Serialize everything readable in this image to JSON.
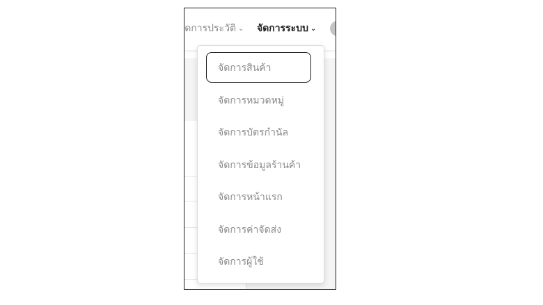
{
  "navbar": {
    "history_label": "จัดการประวัติ",
    "system_label": "จัดการระบบ",
    "chevron": "❯"
  },
  "system_menu": {
    "items": [
      {
        "label": "จัดการสินค้า",
        "focused": true
      },
      {
        "label": "จัดการหมวดหมู่",
        "focused": false
      },
      {
        "label": "จัดการบัตรกำนัล",
        "focused": false
      },
      {
        "label": "จัดการข้อมูลร้านค้า",
        "focused": false
      },
      {
        "label": "จัดการหน้าแรก",
        "focused": false
      },
      {
        "label": "จัดการค่าจัดส่ง",
        "focused": false
      },
      {
        "label": "จัดการผู้ใช้",
        "focused": false
      }
    ]
  },
  "colors": {
    "menu_text": "#8a8a8a",
    "nav_active": "#1f1f1f",
    "focus_border": "#1a1a1a"
  }
}
